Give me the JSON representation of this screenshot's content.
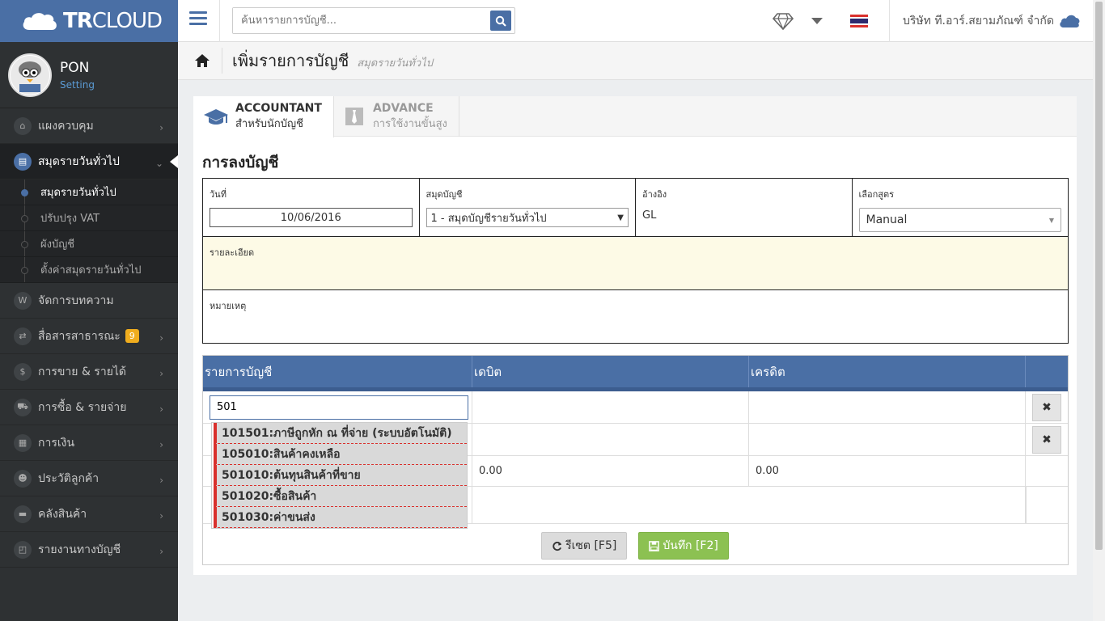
{
  "brand": {
    "name_bold": "TR",
    "name_light": "CLOUD"
  },
  "user": {
    "name": "PON",
    "setting": "Setting"
  },
  "sidebar": {
    "items": [
      {
        "label": "แผงควบคุม",
        "icon": "dashboard-icon"
      },
      {
        "label": "สมุดรายวันทั่วไป",
        "icon": "book-icon"
      },
      {
        "label": "จัดการบทความ",
        "icon": "wordpress-icon"
      },
      {
        "label": "สื่อสารสาธารณะ",
        "icon": "exchange-icon",
        "badge": "9"
      },
      {
        "label": "การขาย & รายได้",
        "icon": "dollar-icon"
      },
      {
        "label": "การซื้อ & รายจ่าย",
        "icon": "cart-icon"
      },
      {
        "label": "การเงิน",
        "icon": "calendar-icon"
      },
      {
        "label": "ประวัติลูกค้า",
        "icon": "users-icon"
      },
      {
        "label": "คลังสินค้า",
        "icon": "truck-icon"
      },
      {
        "label": "รายงานทางบัญชี",
        "icon": "report-icon"
      }
    ],
    "sub_items": [
      {
        "label": "สมุดรายวันทั่วไป"
      },
      {
        "label": "ปรับปรุง VAT"
      },
      {
        "label": "ผังบัญชี"
      },
      {
        "label": "ตั้งค่าสมุดรายวันทั่วไป"
      }
    ]
  },
  "topbar": {
    "search_placeholder": "ค้นหารายการบัญชี...",
    "company": "บริษัท ที.อาร์.สยามภัณฑ์ จำกัด"
  },
  "page": {
    "title": "เพิ่มรายการบัญชี",
    "subtitle": "สมุดรายวันทั่วไป"
  },
  "tabs": [
    {
      "title": "ACCOUNTANT",
      "subtitle": "สำหรับนักบัญชี"
    },
    {
      "title": "ADVANCE",
      "subtitle": "การใช้งานขั้นสูง"
    }
  ],
  "form": {
    "section_title": "การลงบัญชี",
    "date_label": "วันที่",
    "date_value": "10/06/2016",
    "book_label": "สมุดบัญชี",
    "book_value": "1 - สมุดบัญชีรายวันทั่วไป",
    "ref_label": "อ้างอิง",
    "ref_value": "GL",
    "formula_label": "เลือกสูตร",
    "formula_value": "Manual",
    "detail_label": "รายละเอียด",
    "remark_label": "หมายเหตุ"
  },
  "grid": {
    "headers": [
      "รายการบัญชี",
      "เดบิต",
      "เครดิต"
    ],
    "input_value": "501",
    "total_debit": "0.00",
    "total_credit": "0.00",
    "suggestions": [
      "101501:ภาษีถูกหัก ณ ที่จ่าย (ระบบอัตโนมัติ)",
      "105010:สินค้าคงเหลือ",
      "501010:ต้นทุนสินค้าที่ขาย",
      "501020:ซื้อสินค้า",
      "501030:ค่าขนส่ง"
    ]
  },
  "actions": {
    "reset": "รีเซต [F5]",
    "save": "บันทึก [F2]"
  },
  "colors": {
    "primary": "#4a6fa5",
    "sidebar": "#2e3133",
    "save": "#8cc152",
    "badge": "#f0ad1e",
    "flag_red": "#d9302c"
  }
}
